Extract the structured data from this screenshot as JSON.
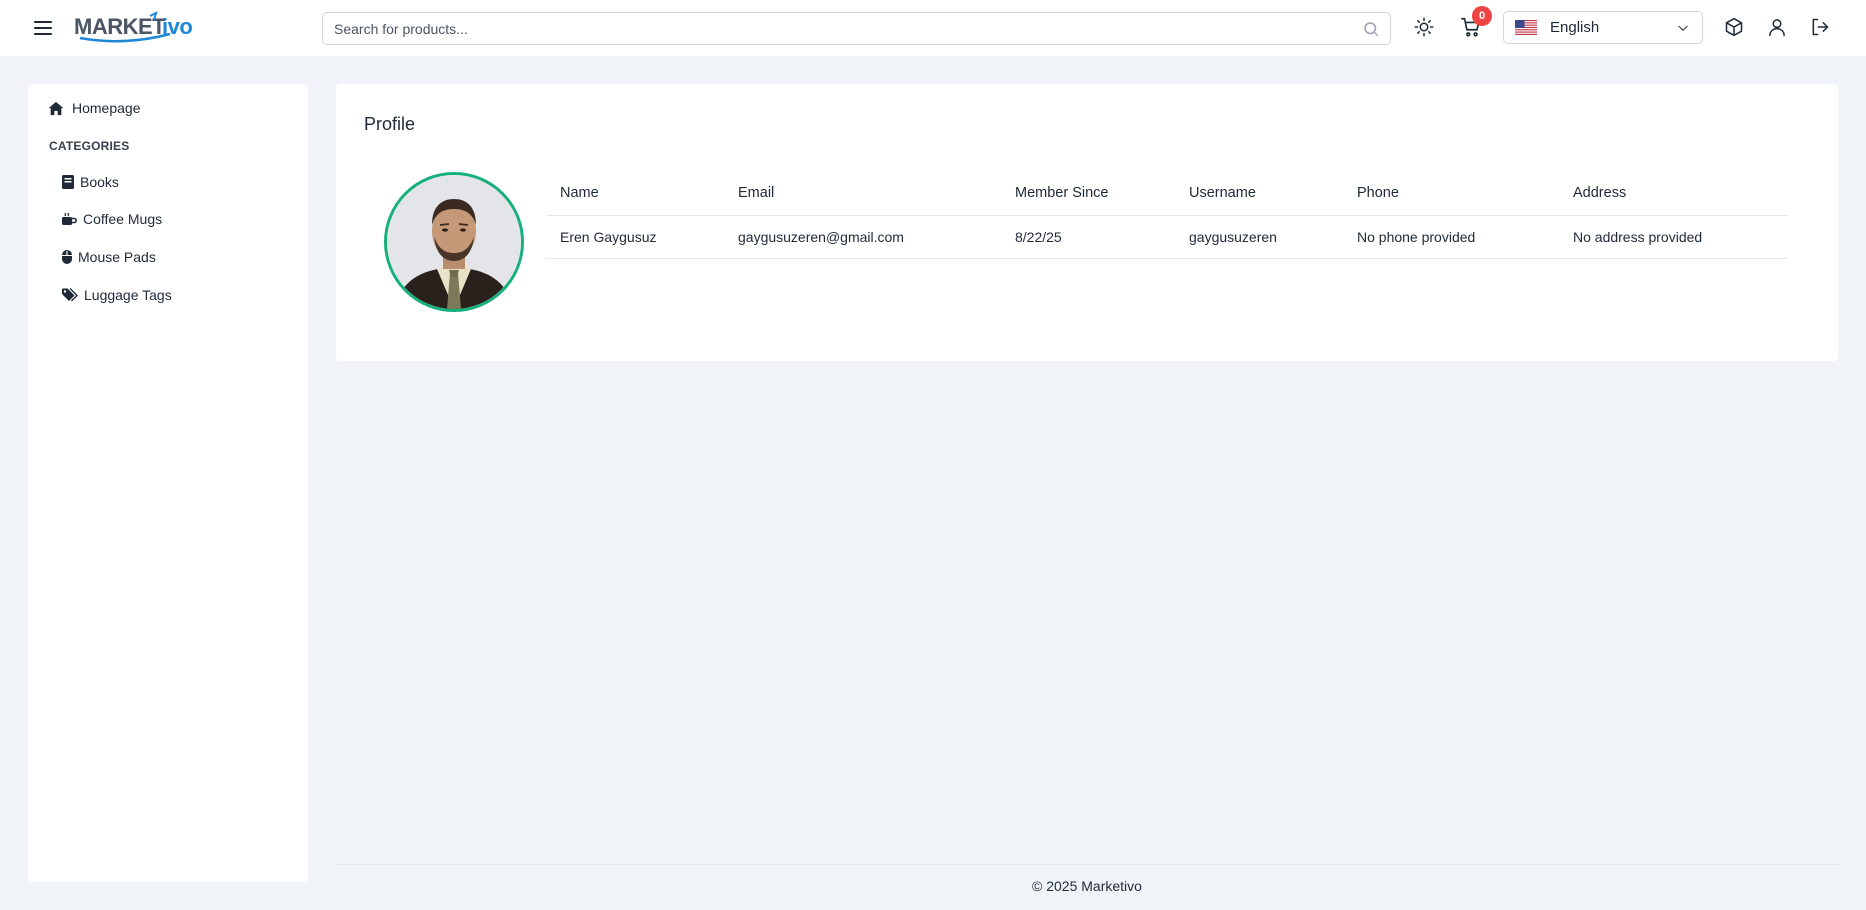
{
  "header": {
    "menu_icon": "hamburger-menu-icon",
    "logo_text": "MARKETivo",
    "search": {
      "placeholder": "Search for products...",
      "value": ""
    },
    "cart_count": "0",
    "language": "English",
    "icons": [
      "sun-icon",
      "cart-icon",
      "cube-icon",
      "user-icon",
      "logout-icon"
    ]
  },
  "sidebar": {
    "home_label": "Homepage",
    "categories_title": "CATEGORIES",
    "items": [
      {
        "label": "Books",
        "icon": "book-icon"
      },
      {
        "label": "Coffee Mugs",
        "icon": "mug-icon"
      },
      {
        "label": "Mouse Pads",
        "icon": "mouse-icon"
      },
      {
        "label": "Luggage Tags",
        "icon": "tags-icon"
      }
    ]
  },
  "profile": {
    "title": "Profile",
    "columns": [
      "Name",
      "Email",
      "Member Since",
      "Username",
      "Phone",
      "Address"
    ],
    "row": [
      "Eren Gaygusuz",
      "gaygusuzeren@gmail.com",
      "8/22/25",
      "gaygusuzeren",
      "No phone provided",
      "No address provided"
    ]
  },
  "footer": {
    "text": "© 2025 Marketivo"
  },
  "colors": {
    "accent_green": "#16b07d",
    "badge_red": "#ef4444",
    "bg": "#f0f3f8"
  }
}
